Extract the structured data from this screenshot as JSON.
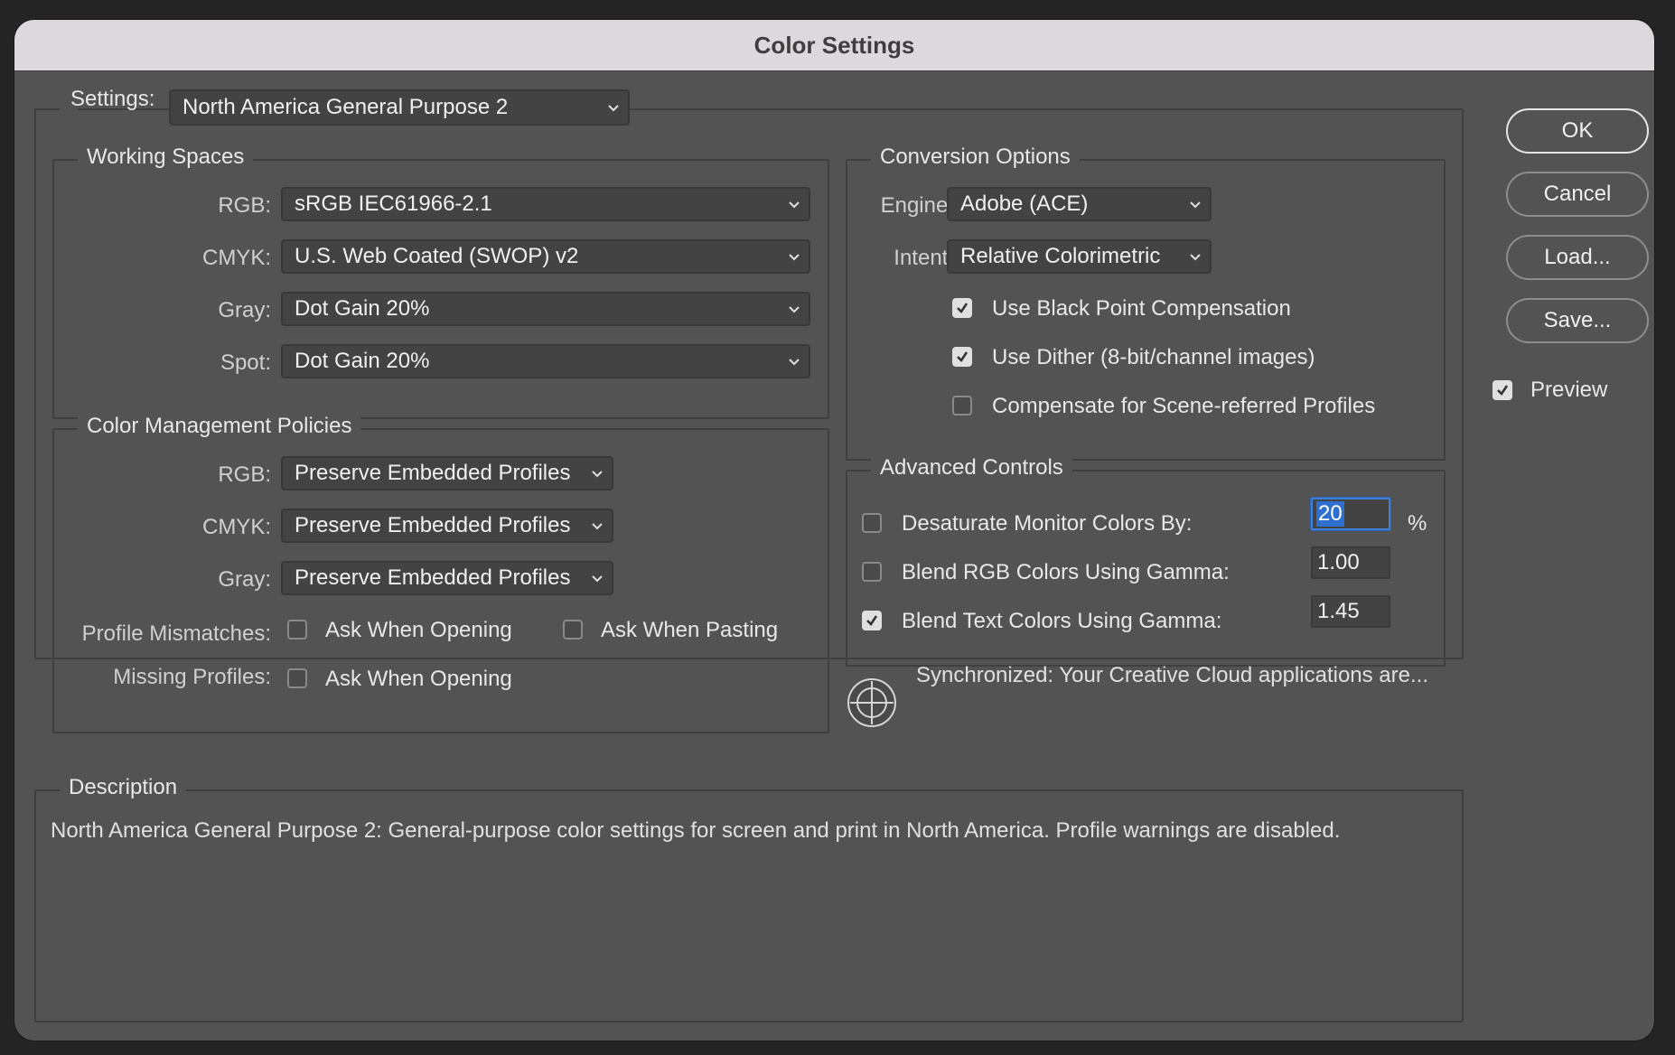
{
  "window": {
    "title": "Color Settings"
  },
  "settings": {
    "label": "Settings:",
    "value": "North America General Purpose 2"
  },
  "working_spaces": {
    "title": "Working Spaces",
    "rows": [
      {
        "label": "RGB:",
        "value": "sRGB IEC61966-2.1"
      },
      {
        "label": "CMYK:",
        "value": "U.S. Web Coated (SWOP) v2"
      },
      {
        "label": "Gray:",
        "value": "Dot Gain 20%"
      },
      {
        "label": "Spot:",
        "value": "Dot Gain 20%"
      }
    ]
  },
  "policies": {
    "title": "Color Management Policies",
    "rows": [
      {
        "label": "RGB:",
        "value": "Preserve Embedded Profiles"
      },
      {
        "label": "CMYK:",
        "value": "Preserve Embedded Profiles"
      },
      {
        "label": "Gray:",
        "value": "Preserve Embedded Profiles"
      }
    ],
    "profile_mismatches": {
      "label": "Profile Mismatches:",
      "ask_opening": {
        "label": "Ask When Opening",
        "checked": false
      },
      "ask_pasting": {
        "label": "Ask When Pasting",
        "checked": false
      }
    },
    "missing_profiles": {
      "label": "Missing Profiles:",
      "ask_opening": {
        "label": "Ask When Opening",
        "checked": false
      }
    }
  },
  "conversion": {
    "title": "Conversion Options",
    "engine": {
      "label": "Engine:",
      "value": "Adobe (ACE)"
    },
    "intent": {
      "label": "Intent:",
      "value": "Relative Colorimetric"
    },
    "options": [
      {
        "label": "Use Black Point Compensation",
        "checked": true
      },
      {
        "label": "Use Dither (8-bit/channel images)",
        "checked": true
      },
      {
        "label": "Compensate for Scene-referred Profiles",
        "checked": false
      }
    ]
  },
  "advanced": {
    "title": "Advanced Controls",
    "desaturate": {
      "label": "Desaturate Monitor Colors By:",
      "checked": false,
      "value": "20",
      "unit": "%"
    },
    "blend_rgb": {
      "label": "Blend RGB Colors Using Gamma:",
      "checked": false,
      "value": "1.00"
    },
    "blend_text": {
      "label": "Blend Text Colors Using Gamma:",
      "checked": true,
      "value": "1.45"
    }
  },
  "sync": {
    "text": "Synchronized: Your Creative Cloud applications are..."
  },
  "description": {
    "title": "Description",
    "text": "North America General Purpose 2:  General-purpose color settings for screen and print in North America. Profile warnings are disabled."
  },
  "buttons": {
    "ok": "OK",
    "cancel": "Cancel",
    "load": "Load...",
    "save": "Save..."
  },
  "preview": {
    "label": "Preview",
    "checked": true
  },
  "colors": {
    "window_bg": "#535353",
    "titlebar": "#dcd8dc",
    "focus": "#2f6fd0"
  },
  "icons": {
    "chevron": "chevron-down-icon",
    "checkmark": "checkmark-icon",
    "sync": "sync-crosshair-icon"
  }
}
